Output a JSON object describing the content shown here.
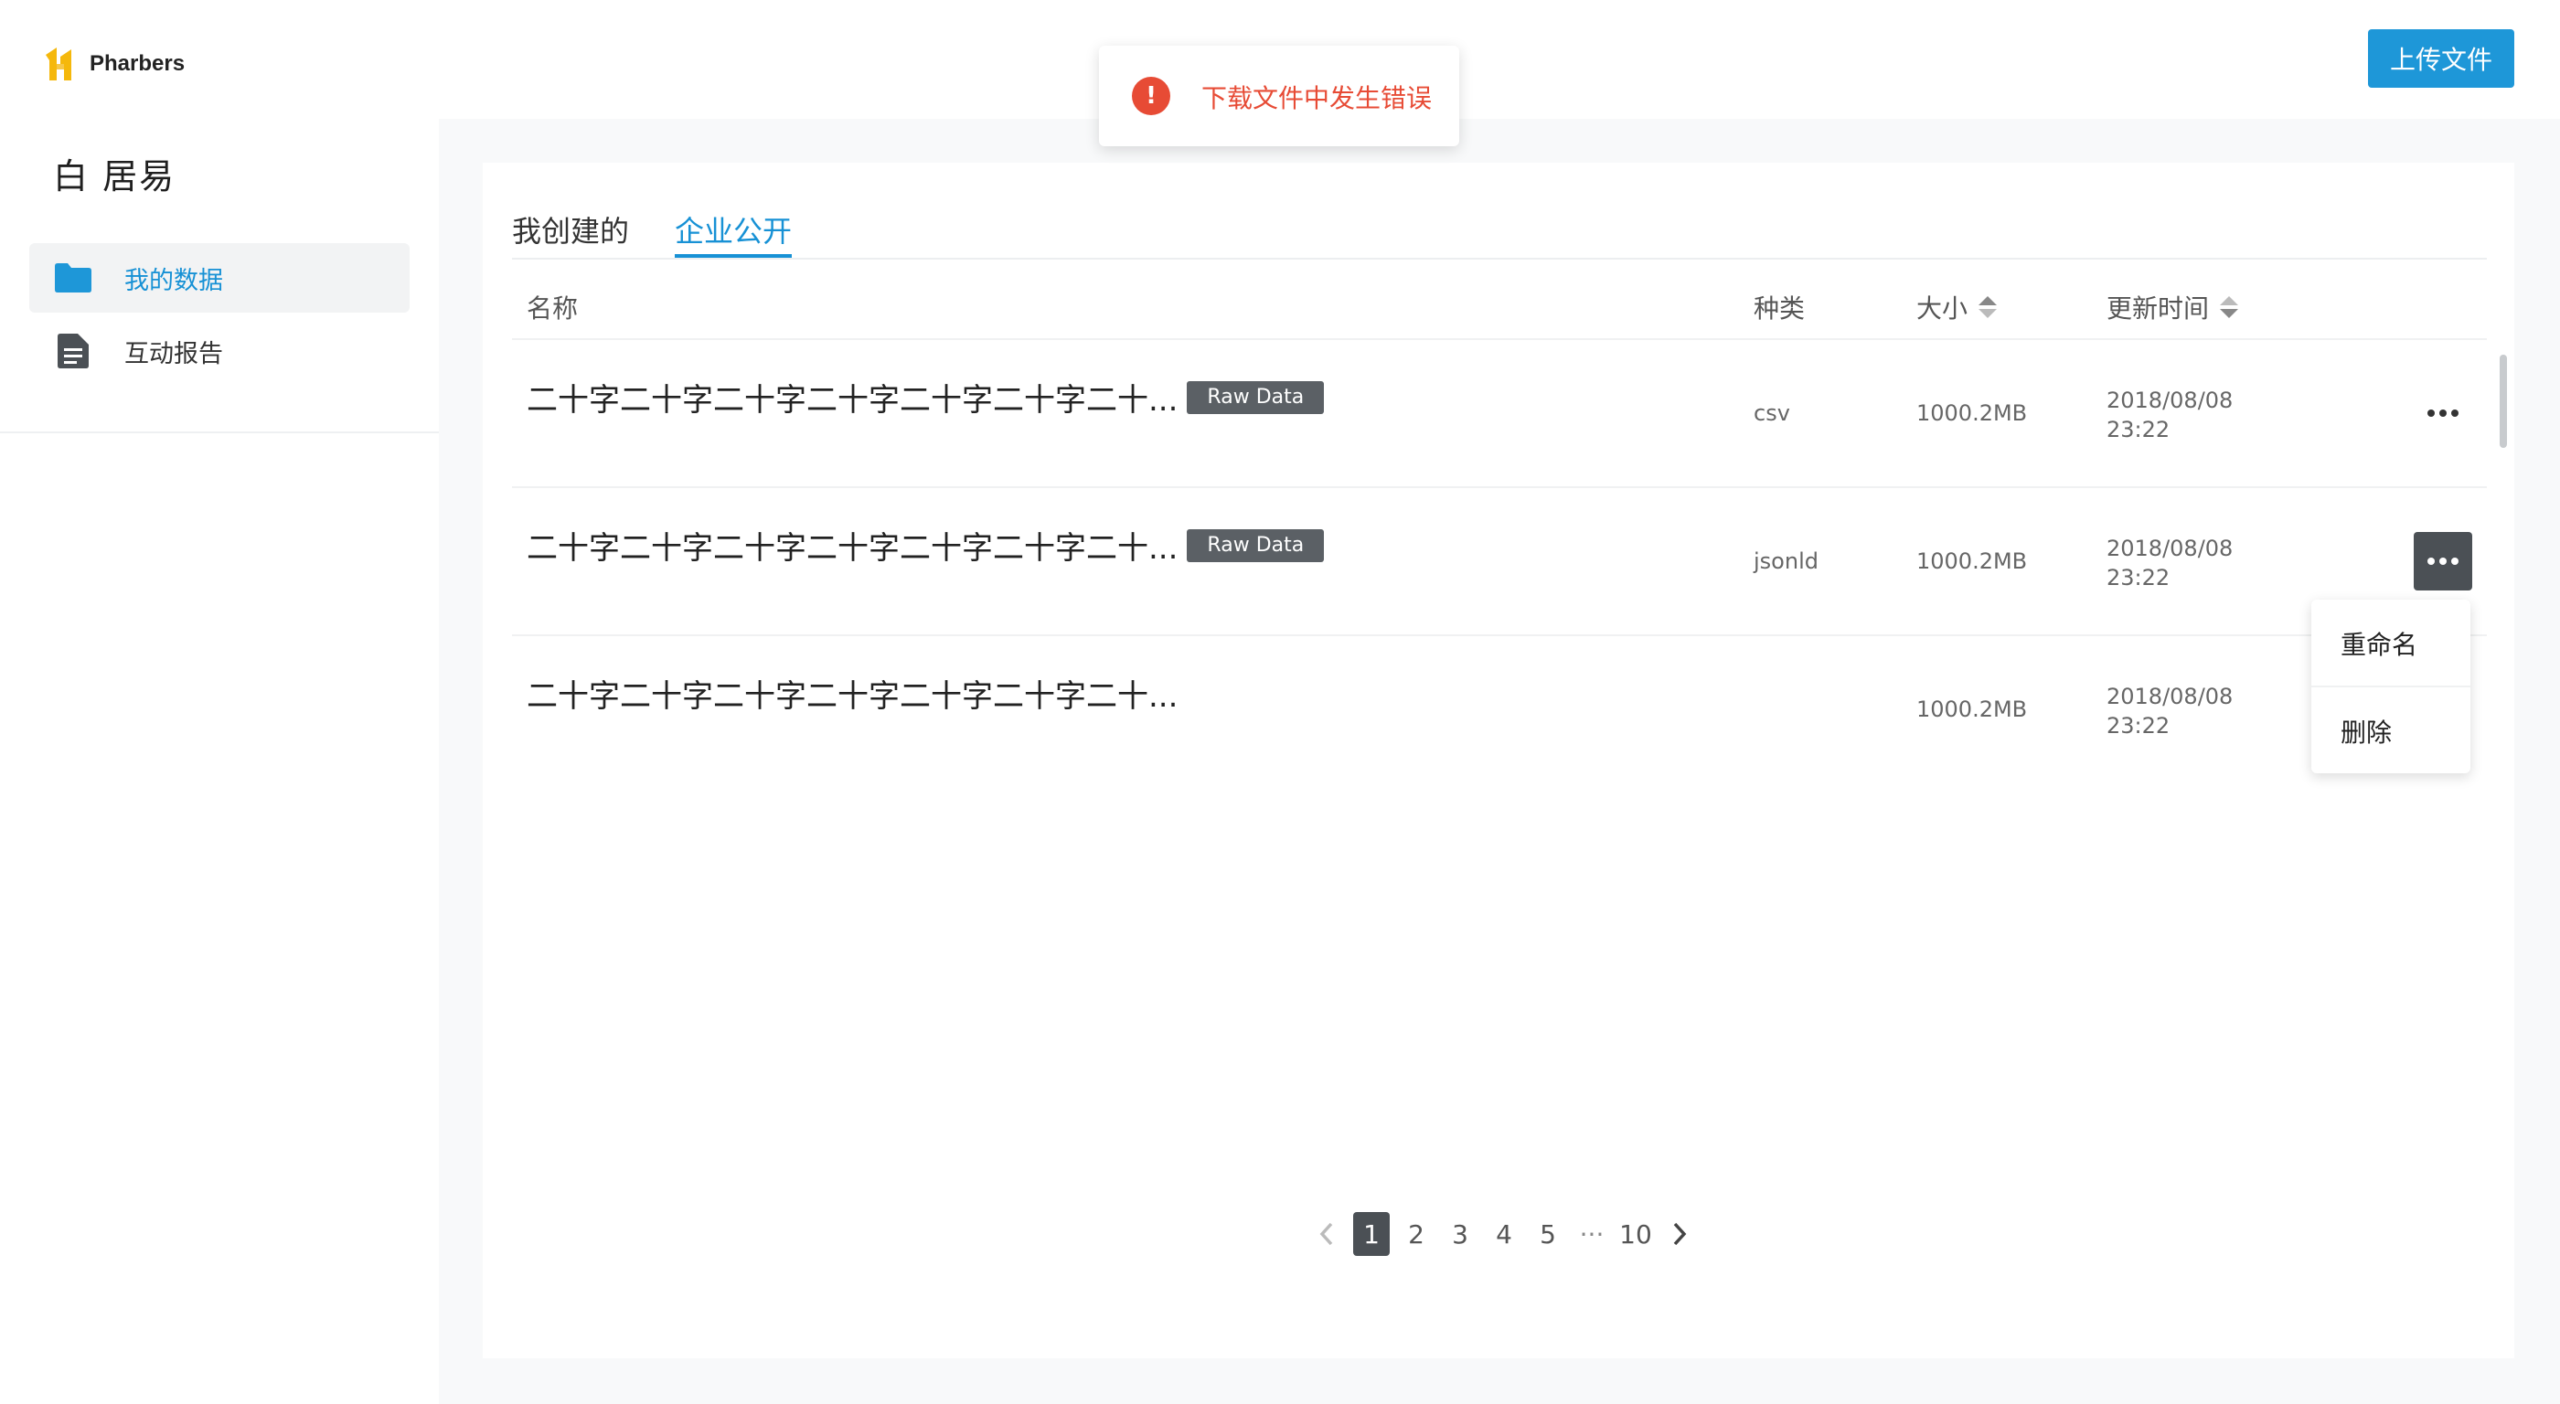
{
  "app": {
    "brand": "Pharbers",
    "brand_colors": [
      "#f5b80c",
      "#1e97d8"
    ]
  },
  "user": {
    "name": "白 居易"
  },
  "sidebar": {
    "items": [
      {
        "label": "我的数据",
        "icon": "folder-icon",
        "active": true
      },
      {
        "label": "互动报告",
        "icon": "document-icon",
        "active": false
      }
    ]
  },
  "header": {
    "upload_label": "上传文件"
  },
  "toast": {
    "message": "下载文件中发生错误",
    "icon": "error-icon",
    "color": "#e74b35"
  },
  "tabs": [
    {
      "label": "我创建的",
      "active": false
    },
    {
      "label": "企业公开",
      "active": true
    }
  ],
  "table": {
    "columns": [
      "名称",
      "种类",
      "大小",
      "更新时间"
    ],
    "rows": [
      {
        "name": "二十字二十字二十字二十字二十字二十字二十...",
        "tag": "Raw Data",
        "type": "csv",
        "size": "1000.2MB",
        "date": "2018/08/08",
        "time": "23:22"
      },
      {
        "name": "二十字二十字二十字二十字二十字二十字二十...",
        "tag": "Raw Data",
        "type": "jsonld",
        "size": "1000.2MB",
        "date": "2018/08/08",
        "time": "23:22"
      },
      {
        "name": "二十字二十字二十字二十字二十字二十字二十...",
        "tag": "",
        "type": "",
        "size": "1000.2MB",
        "date": "2018/08/08",
        "time": "23:22"
      }
    ]
  },
  "row_menu": {
    "rename": "重命名",
    "delete": "删除"
  },
  "pagination": {
    "pages": [
      "1",
      "2",
      "3",
      "4",
      "5"
    ],
    "ellipsis": "···",
    "last": "10",
    "current": "1"
  }
}
